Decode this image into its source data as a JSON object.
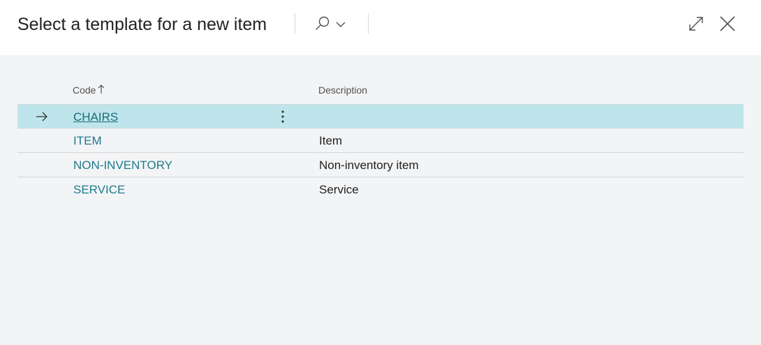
{
  "dialog": {
    "title": "Select a template for a new item"
  },
  "toolbar": {
    "search_icon": "search-icon",
    "search_dropdown_icon": "chevron-down-icon",
    "expand_icon": "expand-icon",
    "close_icon": "close-icon"
  },
  "columns": {
    "code": "Code",
    "code_sort": "ascending",
    "description": "Description"
  },
  "rows": [
    {
      "code": "CHAIRS",
      "description": "",
      "selected": true
    },
    {
      "code": "ITEM",
      "description": "Item",
      "selected": false
    },
    {
      "code": "NON-INVENTORY",
      "description": "Non-inventory item",
      "selected": false
    },
    {
      "code": "SERVICE",
      "description": "Service",
      "selected": false
    }
  ],
  "colors": {
    "accent_link": "#1f7a8c",
    "selected_row": "#bfe5ec",
    "background": "#f3f4f6"
  }
}
